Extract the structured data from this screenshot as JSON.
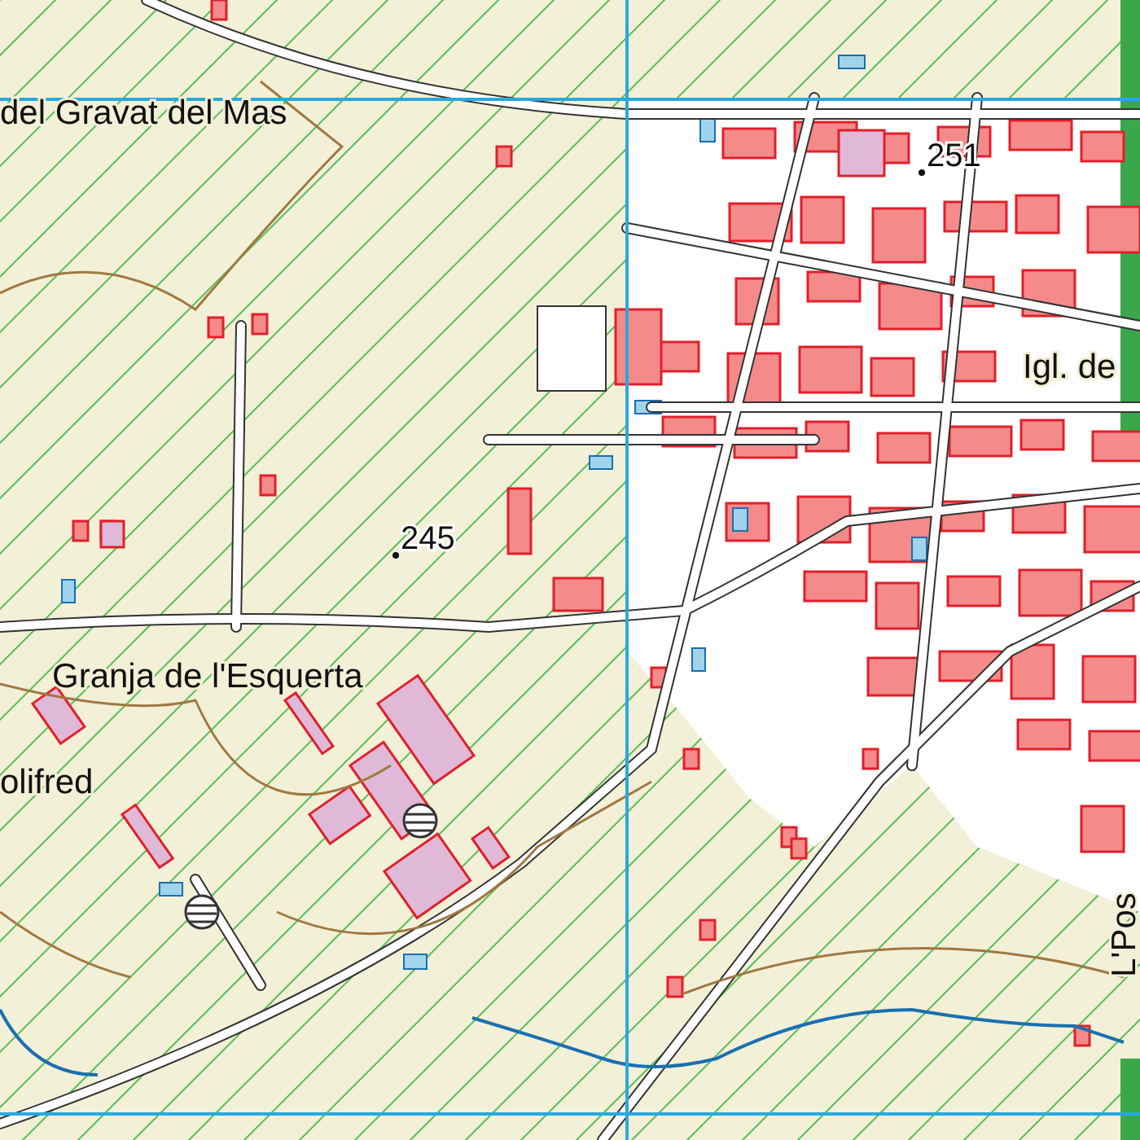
{
  "map": {
    "labels": [
      {
        "text": "del Gravat del Mas",
        "kind": "place"
      },
      {
        "text": "Granja de l'Esquerta",
        "kind": "place"
      },
      {
        "text": "olifred",
        "kind": "place"
      },
      {
        "text": "Igl. de",
        "kind": "place"
      },
      {
        "text": "L'Pos",
        "kind": "vertical"
      }
    ],
    "spot_heights": [
      {
        "value": "251"
      },
      {
        "value": "245"
      }
    ]
  }
}
